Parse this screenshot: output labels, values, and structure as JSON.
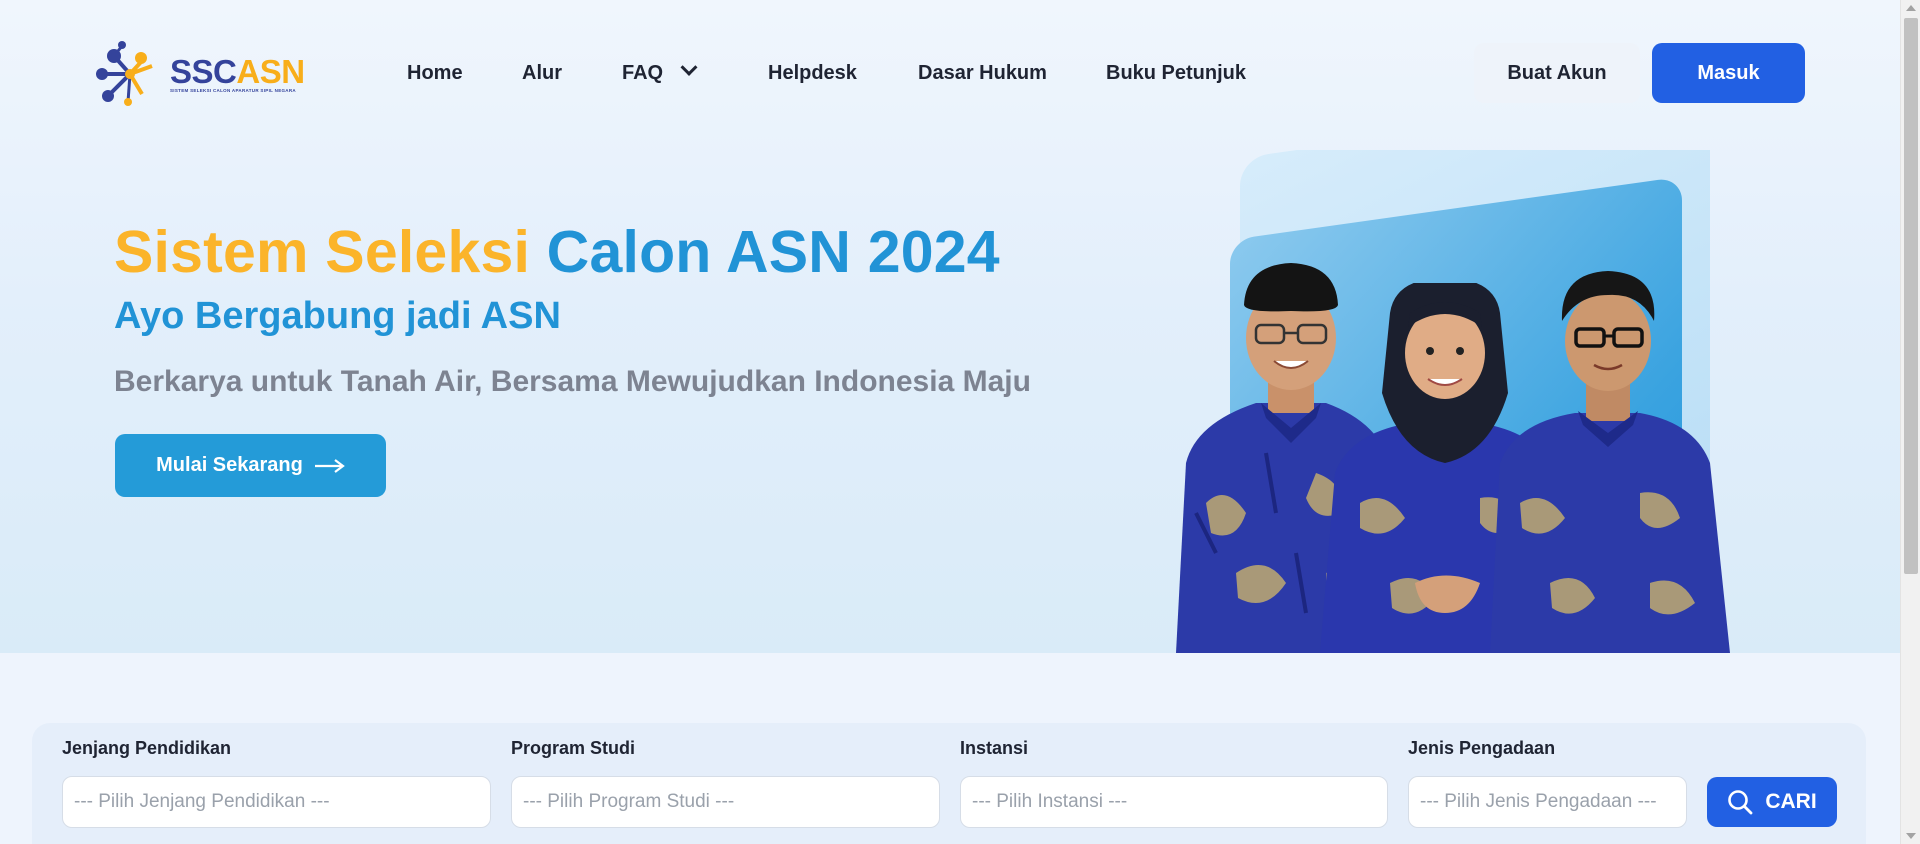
{
  "brand": {
    "logo_text_primary": "SSC",
    "logo_text_accent": "ASN",
    "logo_subtitle": "SISTEM SELEKSI CALON APARATUR SIPIL NEGARA"
  },
  "nav": {
    "items": [
      {
        "label": "Home"
      },
      {
        "label": "Alur"
      },
      {
        "label": "FAQ"
      },
      {
        "label": "Helpdesk"
      },
      {
        "label": "Dasar Hukum"
      },
      {
        "label": "Buku Petunjuk"
      }
    ],
    "register_label": "Buat Akun",
    "login_label": "Masuk"
  },
  "hero": {
    "title_part1": "Sistem Seleksi",
    "title_part2": "Calon ASN 2024",
    "subtitle": "Ayo Bergabung jadi ASN",
    "tagline": "Berkarya untuk Tanah Air, Bersama Mewujudkan Indonesia Maju",
    "cta_label": "Mulai Sekarang"
  },
  "search": {
    "fields": [
      {
        "label": "Jenjang Pendidikan",
        "placeholder": "--- Pilih Jenjang Pendidikan ---"
      },
      {
        "label": "Program Studi",
        "placeholder": "--- Pilih Program Studi ---"
      },
      {
        "label": "Instansi",
        "placeholder": "--- Pilih Instansi ---"
      },
      {
        "label": "Jenis Pengadaan",
        "placeholder": "--- Pilih Jenis Pengadaan ---"
      }
    ],
    "button_label": "CARI"
  },
  "colors": {
    "brand_blue": "#2260e3",
    "accent_orange": "#fbb42a",
    "accent_sky": "#2193d6"
  }
}
